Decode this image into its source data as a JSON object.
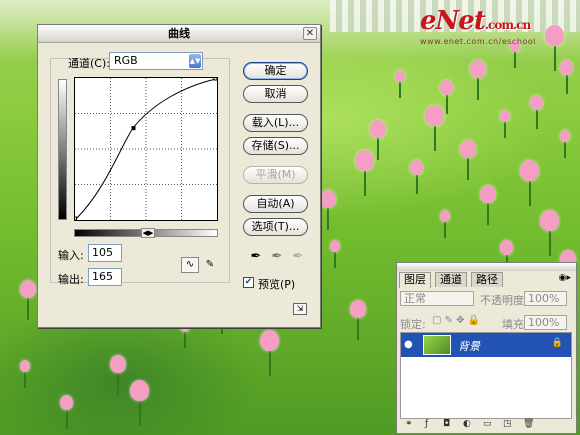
{
  "watermark": {
    "logo": "eNet",
    "logo_suffix": ".com.cn",
    "url": "www.enet.com.cn/eschool"
  },
  "curves_dialog": {
    "title": "曲线",
    "channel_label": "通道(C):",
    "channel_value": "RGB",
    "input_label": "输入:",
    "input_value": "105",
    "output_label": "输出:",
    "output_value": "165",
    "buttons": {
      "ok": "确定",
      "cancel": "取消",
      "load": "载入(L)...",
      "save": "存储(S)...",
      "smooth": "平滑(M)",
      "auto": "自动(A)",
      "options": "选项(T)..."
    },
    "preview_label": "预览(P)",
    "preview_checked": true,
    "curve_point": {
      "input": 105,
      "output": 165
    },
    "icons": {
      "close": "close-icon",
      "curve_tool": "curve-point-tool-icon",
      "pencil": "pencil-tool-icon"
    }
  },
  "layers_panel": {
    "tabs": [
      "图层",
      "通道",
      "路径"
    ],
    "active_tab": 0,
    "blend_mode": "正常",
    "opacity_label": "不透明度:",
    "opacity_value": "100%",
    "lock_label": "锁定:",
    "fill_label": "填充:",
    "fill_value": "100%",
    "layer_name": "背景",
    "layer_selected": true
  },
  "colors": {
    "dialog_bg": "#ece9d8",
    "selection": "#2253b4",
    "tulip": "#f39ec2",
    "grass": "#72bb2e"
  }
}
